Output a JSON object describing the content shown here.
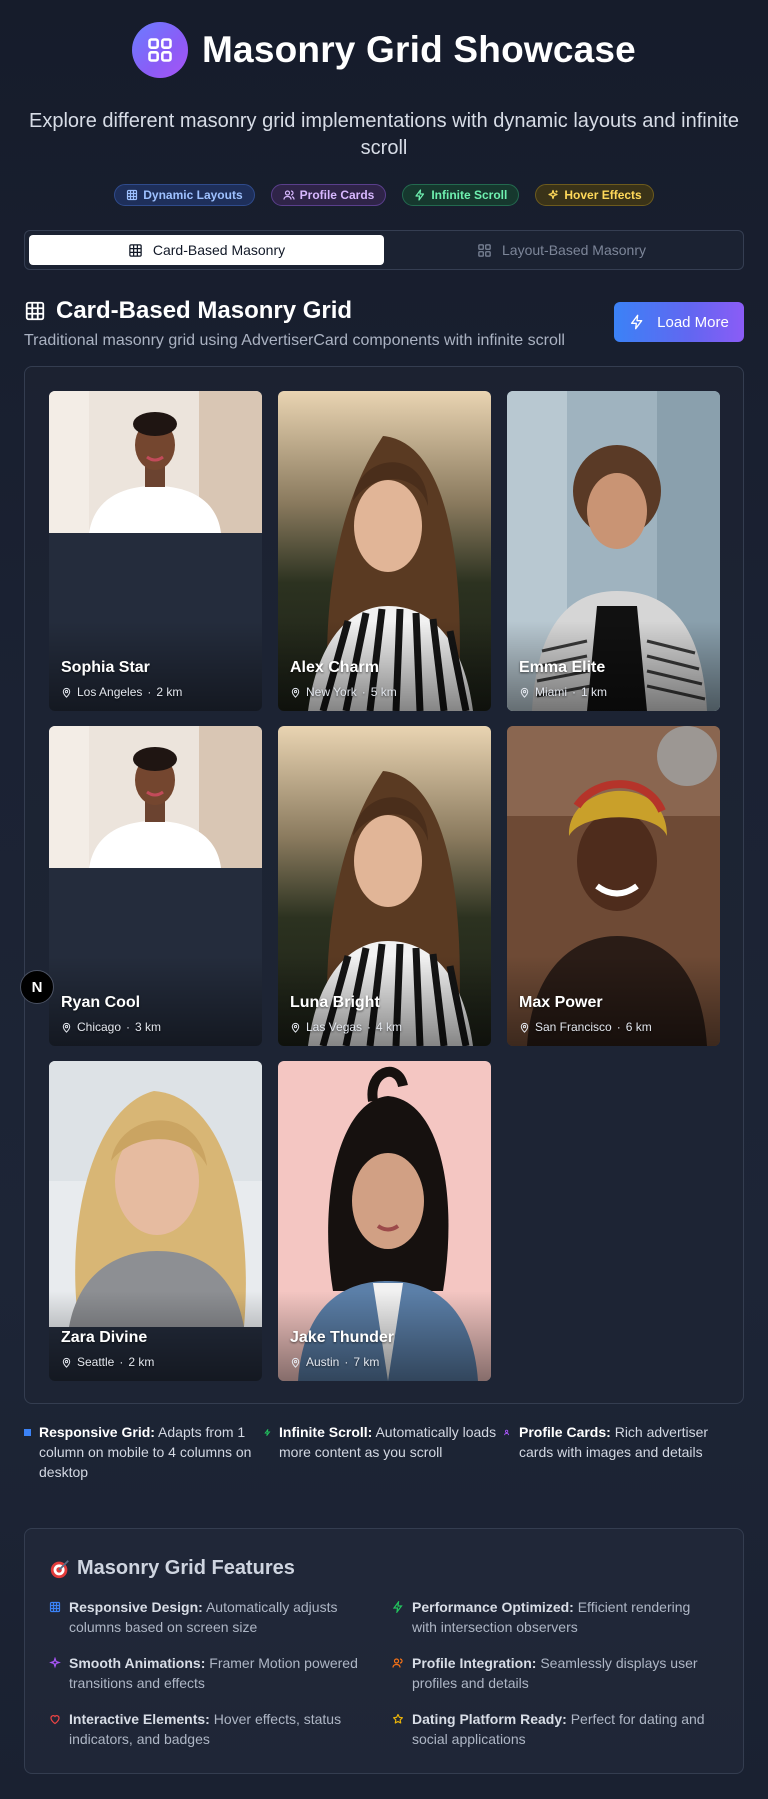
{
  "header": {
    "title": "Masonry Grid Showcase",
    "subtitle": "Explore different masonry grid implementations with dynamic layouts and infinite scroll",
    "badges": [
      "Dynamic Layouts",
      "Profile Cards",
      "Infinite Scroll",
      "Hover Effects"
    ]
  },
  "tabs": [
    {
      "label": "Card-Based Masonry",
      "active": true
    },
    {
      "label": "Layout-Based Masonry",
      "active": false
    }
  ],
  "section": {
    "title": "Card-Based Masonry Grid",
    "description": "Traditional masonry grid using AdvertiserCard components with infinite scroll",
    "load_more": "Load More"
  },
  "cards": [
    {
      "name": "Sophia Star",
      "location": "Los Angeles",
      "distance": "2 km"
    },
    {
      "name": "Alex Charm",
      "location": "New York",
      "distance": "5 km"
    },
    {
      "name": "Emma Elite",
      "location": "Miami",
      "distance": "1 km"
    },
    {
      "name": "Ryan Cool",
      "location": "Chicago",
      "distance": "3 km"
    },
    {
      "name": "Luna Bright",
      "location": "Las Vegas",
      "distance": "4 km"
    },
    {
      "name": "Max Power",
      "location": "San Francisco",
      "distance": "6 km"
    },
    {
      "name": "Zara Divine",
      "location": "Seattle",
      "distance": "2 km"
    },
    {
      "name": "Jake Thunder",
      "location": "Austin",
      "distance": "7 km"
    }
  ],
  "notes": [
    {
      "title": "Responsive Grid:",
      "text": "Adapts from 1 column on mobile to 4 columns on desktop",
      "color": "#3b82f6"
    },
    {
      "title": "Infinite Scroll:",
      "text": "Automatically loads more content as you scroll",
      "color": "#22c55e"
    },
    {
      "title": "Profile Cards:",
      "text": "Rich advertiser cards with images and details",
      "color": "#a855f7"
    }
  ],
  "features": {
    "title": "Masonry Grid Features",
    "items": [
      {
        "title": "Responsive Design:",
        "text": "Automatically adjusts columns based on screen size",
        "icon": "grid-icon",
        "color": "#3b82f6"
      },
      {
        "title": "Performance Optimized:",
        "text": "Efficient rendering with intersection observers",
        "icon": "zap-icon",
        "color": "#22c55e"
      },
      {
        "title": "Smooth Animations:",
        "text": "Framer Motion powered transitions and effects",
        "icon": "sparkles-icon",
        "color": "#a855f7"
      },
      {
        "title": "Profile Integration:",
        "text": "Seamlessly displays user profiles and details",
        "icon": "users-icon",
        "color": "#f97316"
      },
      {
        "title": "Interactive Elements:",
        "text": "Hover effects, status indicators, and badges",
        "icon": "heart-icon",
        "color": "#ef4444"
      },
      {
        "title": "Dating Platform Ready:",
        "text": "Perfect for dating and social applications",
        "icon": "star-icon",
        "color": "#eab308"
      }
    ]
  },
  "fab_label": "N"
}
